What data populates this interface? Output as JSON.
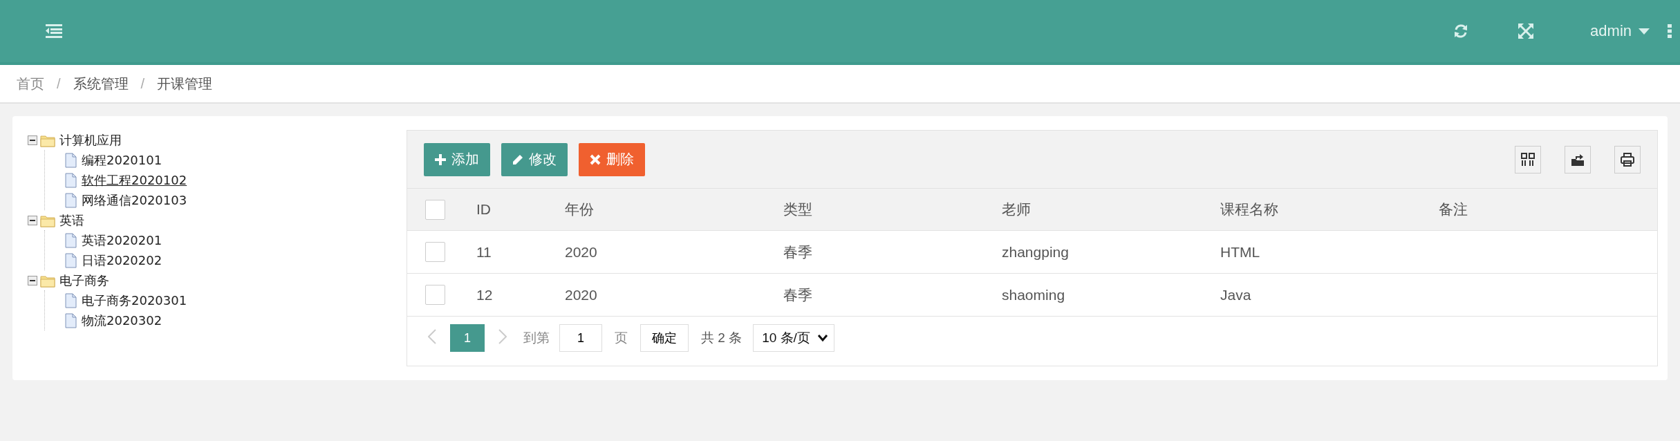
{
  "header": {
    "user": "admin"
  },
  "breadcrumb": {
    "separator": "/",
    "items": [
      "首页",
      "系统管理",
      "开课管理"
    ]
  },
  "tree": [
    {
      "label": "计算机应用",
      "expanded": true,
      "children": [
        {
          "label": "编程2020101",
          "selected": false
        },
        {
          "label": "软件工程2020102",
          "selected": true
        },
        {
          "label": "网络通信2020103",
          "selected": false
        }
      ]
    },
    {
      "label": "英语",
      "expanded": true,
      "children": [
        {
          "label": "英语2020201",
          "selected": false
        },
        {
          "label": "日语2020202",
          "selected": false
        }
      ]
    },
    {
      "label": "电子商务",
      "expanded": true,
      "children": [
        {
          "label": "电子商务2020301",
          "selected": false
        },
        {
          "label": "物流2020302",
          "selected": false
        }
      ]
    }
  ],
  "toolbar": [
    {
      "kind": "add",
      "label": "添加"
    },
    {
      "kind": "edit",
      "label": "修改"
    },
    {
      "kind": "delete",
      "label": "删除"
    }
  ],
  "table": {
    "columns": [
      "ID",
      "年份",
      "类型",
      "老师",
      "课程名称",
      "备注"
    ],
    "all_checked": false,
    "rows": [
      {
        "checked": false,
        "cells": [
          "11",
          "2020",
          "春季",
          "zhangping",
          "HTML"
        ]
      },
      {
        "checked": false,
        "cells": [
          "12",
          "2020",
          "春季",
          "shaoming",
          "Java"
        ]
      }
    ]
  },
  "pager": {
    "pages": [
      {
        "label": "1",
        "selected": true
      }
    ],
    "goto_label": "到第",
    "goto_value": "1",
    "page_unit": "页",
    "confirm": "确定",
    "total": "共 2 条",
    "page_size": "10 条/页"
  }
}
